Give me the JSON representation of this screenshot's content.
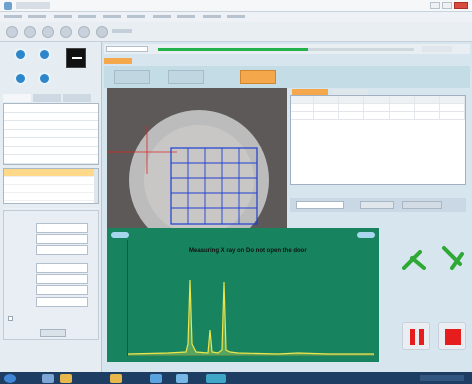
{
  "window": {
    "title": ""
  },
  "menu": {
    "items": [
      "",
      "",
      "",
      "",
      "",
      "",
      "",
      "",
      "",
      ""
    ]
  },
  "left_panel": {
    "tabs": [
      "",
      "",
      ""
    ],
    "params": [
      {
        "k": "",
        "v": ""
      },
      {
        "k": "",
        "v": ""
      },
      {
        "k": "",
        "v": ""
      },
      {
        "k": "",
        "v": ""
      },
      {
        "k": "",
        "v": ""
      },
      {
        "k": "",
        "v": ""
      },
      {
        "k": "",
        "v": ""
      },
      {
        "k": "",
        "v": ""
      }
    ],
    "elements": [
      "",
      "",
      "",
      "",
      "",
      ""
    ],
    "test_group_title": "",
    "fields": [
      "",
      "",
      "",
      "",
      "",
      "",
      "",
      ""
    ],
    "ok_label": ""
  },
  "main": {
    "measure_tab": "",
    "measure_buttons": [
      "",
      "",
      ""
    ],
    "result_tabs": [
      "",
      ""
    ],
    "result_headers": [
      "",
      "",
      "",
      "",
      "",
      "",
      ""
    ],
    "result_rows": [
      [
        "",
        "",
        "",
        "",
        "",
        "",
        ""
      ],
      [
        "",
        "",
        "",
        "",
        "",
        "",
        ""
      ]
    ],
    "grid_cells": [
      [
        "",
        "",
        "",
        "",
        ""
      ],
      [
        "",
        "",
        "",
        "",
        ""
      ],
      [
        "",
        "",
        "",
        "",
        ""
      ],
      [
        "",
        "",
        "",
        "",
        ""
      ],
      [
        "",
        "",
        "",
        "",
        ""
      ]
    ],
    "spectrum": {
      "status_text": "Measuring   X ray on   Do not open the door",
      "peak_count": 3
    }
  },
  "colors": {
    "accent_orange": "#f5a74c",
    "spectrum_bg": "#17845f",
    "spectrum_line": "#f2e64a",
    "grid_blue": "#1f3fd1",
    "stop_red": "#e51d1d",
    "arrow_green": "#2fa836"
  }
}
